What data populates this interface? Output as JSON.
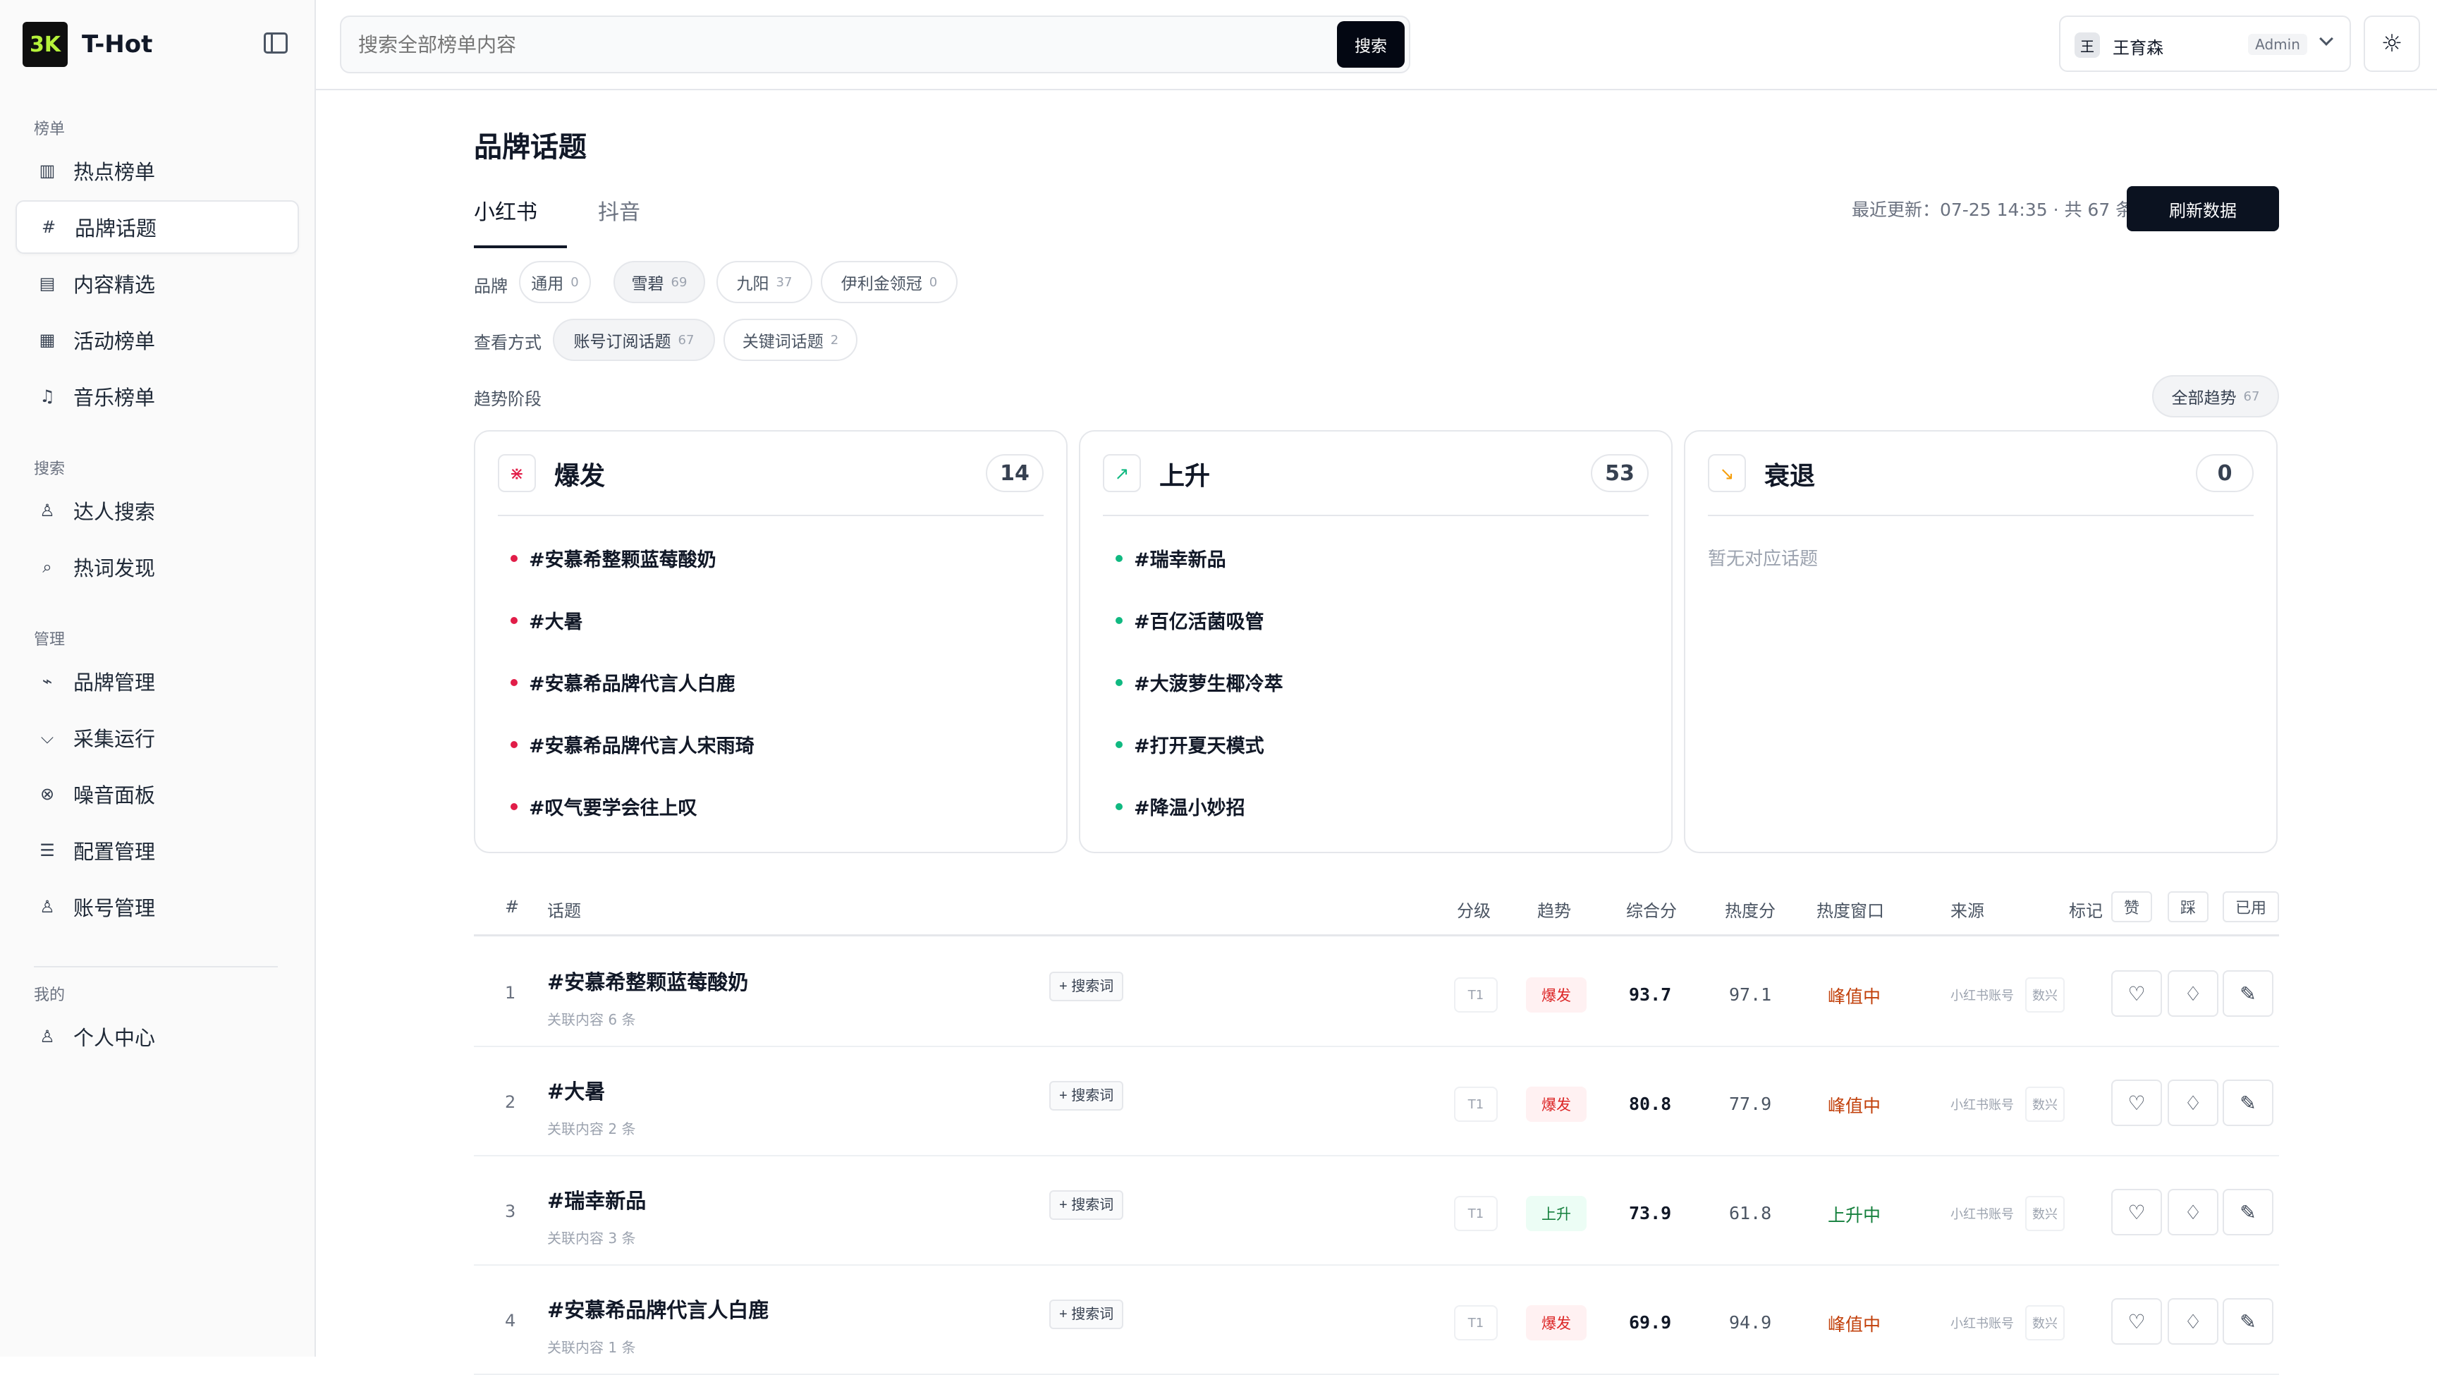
{
  "app": {
    "name": "T-Hot",
    "logo": "3K"
  },
  "sidebar": {
    "groups": [
      {
        "title": "榜单",
        "items": [
          {
            "label": "热点榜单",
            "icon": "bar-chart-icon",
            "glyph": "▥"
          },
          {
            "label": "品牌话题",
            "icon": "hash-icon",
            "glyph": "#",
            "active": true
          },
          {
            "label": "内容精选",
            "icon": "document-icon",
            "glyph": "▤"
          },
          {
            "label": "活动榜单",
            "icon": "calendar-icon",
            "glyph": "▦"
          },
          {
            "label": "音乐榜单",
            "icon": "music-icon",
            "glyph": "♫"
          }
        ]
      },
      {
        "title": "搜索",
        "items": [
          {
            "label": "达人搜索",
            "icon": "people-search-icon",
            "glyph": "♙"
          },
          {
            "label": "热词发现",
            "icon": "keyword-discovery-icon",
            "glyph": "⌕"
          }
        ]
      },
      {
        "title": "管理",
        "items": [
          {
            "label": "品牌管理",
            "icon": "megaphone-icon",
            "glyph": "⌁"
          },
          {
            "label": "采集运行",
            "icon": "filter-run-icon",
            "glyph": "⌵"
          },
          {
            "label": "噪音面板",
            "icon": "noise-icon",
            "glyph": "⊗"
          },
          {
            "label": "配置管理",
            "icon": "settings-sliders-icon",
            "glyph": "☰"
          },
          {
            "label": "账号管理",
            "icon": "users-icon",
            "glyph": "♙"
          }
        ]
      },
      {
        "title": "我的",
        "items": [
          {
            "label": "个人中心",
            "icon": "user-icon",
            "glyph": "♙"
          }
        ]
      }
    ]
  },
  "header": {
    "search_placeholder": "搜索全部榜单内容",
    "search_button": "搜索",
    "user": {
      "avatar": "王",
      "name": "王育森",
      "role": "Admin"
    },
    "theme_icon": "sun-icon"
  },
  "main": {
    "title": "品牌话题",
    "tabs": [
      {
        "label": "小红书",
        "active": true
      },
      {
        "label": "抖音",
        "active": false
      }
    ],
    "meta": "最近更新：07-25 14:35 · 共 67 条",
    "refresh_button": "刷新数据",
    "brand_label": "品牌",
    "brands": [
      {
        "label": "通用",
        "count": "0"
      },
      {
        "label": "雪碧",
        "count": "69",
        "active": true
      },
      {
        "label": "九阳",
        "count": "37"
      },
      {
        "label": "伊利金领冠",
        "count": "0"
      }
    ],
    "view_label": "查看方式",
    "views": [
      {
        "label": "账号订阅话题",
        "count": "67",
        "active": true
      },
      {
        "label": "关键词话题",
        "count": "2"
      }
    ],
    "trend_label": "趋势阶段",
    "all_trends": {
      "label": "全部趋势",
      "count": "67"
    },
    "trend_cards": [
      {
        "title": "爆发",
        "count": "14",
        "icon": "burst-icon",
        "glyph": "⋇",
        "color": "#e11d48",
        "topics": [
          "#安慕希整颗蓝莓酸奶",
          "#大暑",
          "#安慕希品牌代言人白鹿",
          "#安慕希品牌代言人宋雨琦",
          "#叹气要学会往上叹"
        ]
      },
      {
        "title": "上升",
        "count": "53",
        "icon": "trend-up-icon",
        "glyph": "↗",
        "color": "#10b981",
        "topics": [
          "#瑞幸新品",
          "#百亿活菌吸管",
          "#大菠萝生椰冷萃",
          "#打开夏天模式",
          "#降温小妙招"
        ]
      },
      {
        "title": "衰退",
        "count": "0",
        "icon": "trend-down-icon",
        "glyph": "↘",
        "color": "#f59e0b",
        "topics": [],
        "empty": "暂无对应话题"
      }
    ],
    "table": {
      "headers": {
        "index": "#",
        "topic": "话题",
        "grade": "分级",
        "trend": "趋势",
        "score": "综合分",
        "heat": "热度分",
        "window": "热度窗口",
        "source": "来源",
        "mark": "标记",
        "like": "赞",
        "dislike": "踩",
        "used": "已用"
      },
      "rows": [
        {
          "rank": "1",
          "title": "#安慕希整颗蓝莓酸奶",
          "sub": "关联内容 6 条",
          "keyword": "+ 搜索词",
          "grade": "T1",
          "trend": "爆发",
          "trend_type": "burst",
          "score": "93.7",
          "heat": "97.1",
          "window": "峰值中",
          "window_type": "peak",
          "source": "小红书账号",
          "source_tag": "数兴"
        },
        {
          "rank": "2",
          "title": "#大暑",
          "sub": "关联内容 2 条",
          "keyword": "+ 搜索词",
          "grade": "T1",
          "trend": "爆发",
          "trend_type": "burst",
          "score": "80.8",
          "heat": "77.9",
          "window": "峰值中",
          "window_type": "peak",
          "source": "小红书账号",
          "source_tag": "数兴"
        },
        {
          "rank": "3",
          "title": "#瑞幸新品",
          "sub": "关联内容 3 条",
          "keyword": "+ 搜索词",
          "grade": "T1",
          "trend": "上升",
          "trend_type": "rise",
          "score": "73.9",
          "heat": "61.8",
          "window": "上升中",
          "window_type": "rising",
          "source": "小红书账号",
          "source_tag": "数兴"
        },
        {
          "rank": "4",
          "title": "#安慕希品牌代言人白鹿",
          "sub": "关联内容 1 条",
          "keyword": "+ 搜索词",
          "grade": "T1",
          "trend": "爆发",
          "trend_type": "burst",
          "score": "69.9",
          "heat": "94.9",
          "window": "峰值中",
          "window_type": "peak",
          "source": "小红书账号",
          "source_tag": "数兴"
        }
      ]
    }
  }
}
